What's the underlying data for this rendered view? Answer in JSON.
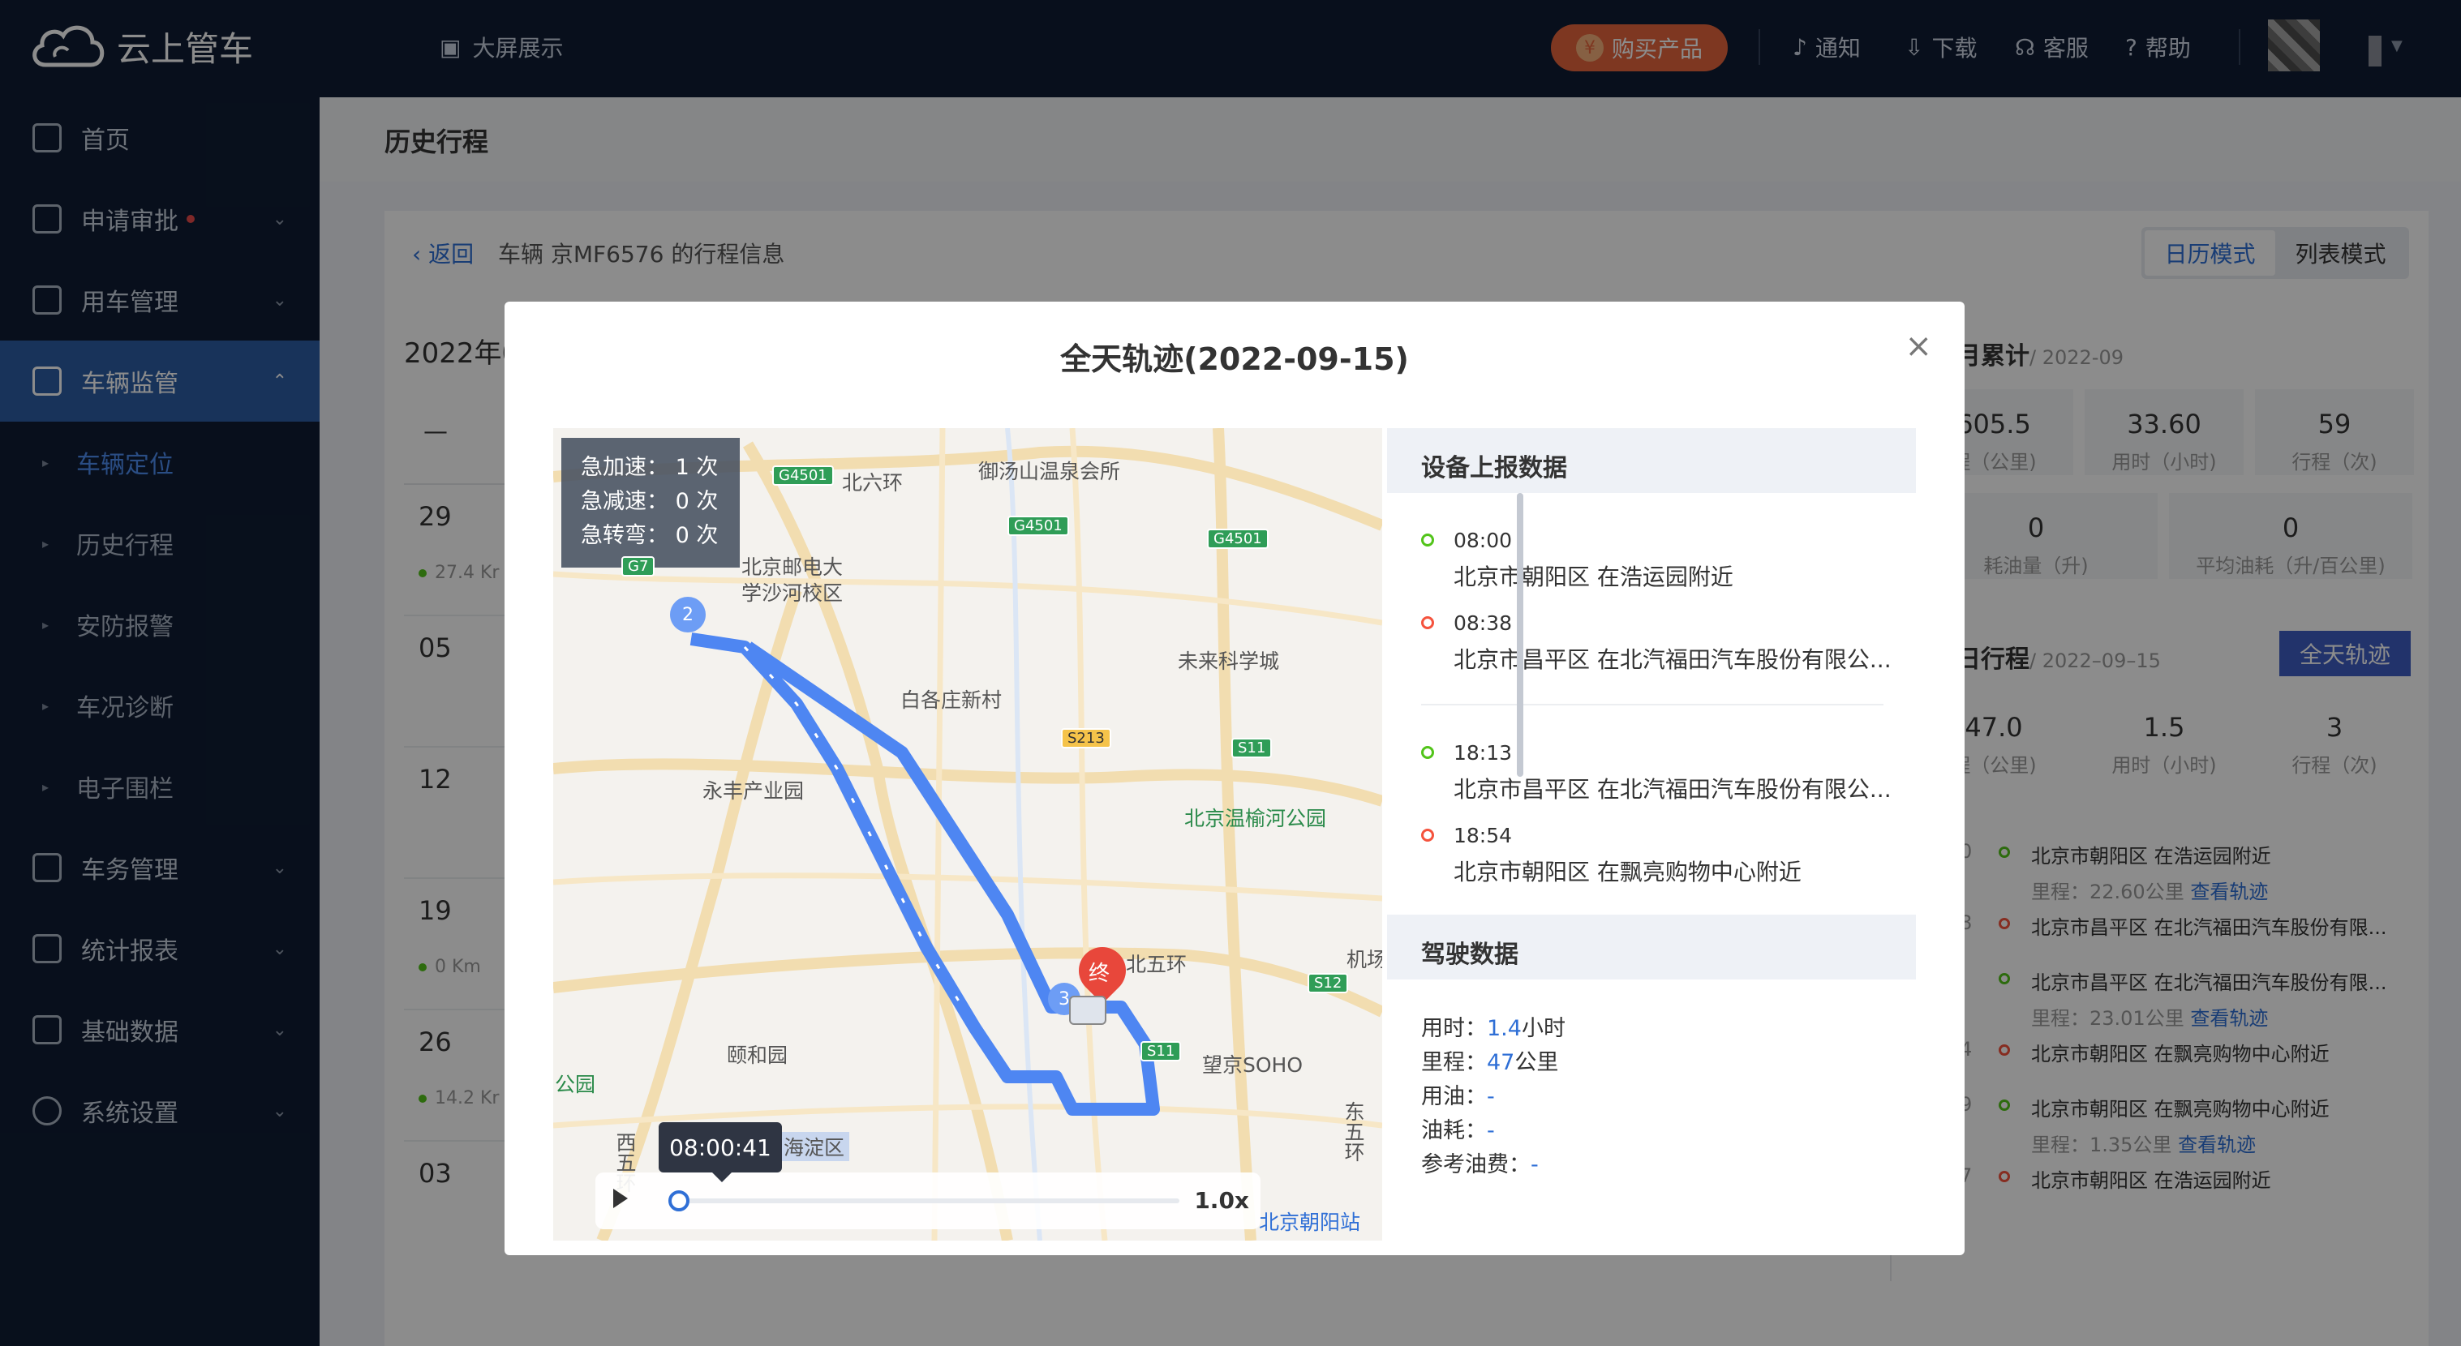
{
  "topbar": {
    "brand": "云上管车",
    "big_screen": "大屏展示",
    "buy": "购买产品",
    "notify": "通知",
    "download": "下载",
    "service": "客服",
    "help": "帮助"
  },
  "sidebar": {
    "items": [
      {
        "label": "首页"
      },
      {
        "label": "申请审批"
      },
      {
        "label": "用车管理"
      },
      {
        "label": "车辆监管"
      },
      {
        "label": "车务管理"
      },
      {
        "label": "统计报表"
      },
      {
        "label": "基础数据"
      },
      {
        "label": "系统设置"
      }
    ],
    "sub_items": [
      {
        "label": "车辆定位"
      },
      {
        "label": "历史行程"
      },
      {
        "label": "安防报警"
      },
      {
        "label": "车况诊断"
      },
      {
        "label": "电子围栏"
      }
    ]
  },
  "page": {
    "title": "历史行程",
    "back": "返回",
    "vehicle_info": "车辆 京MF6576 的行程信息",
    "mode_calendar": "日历模式",
    "mode_list": "列表模式",
    "calendar_title": "2022年0",
    "calendar_dash": "—",
    "weeks": [
      {
        "date": "29",
        "km": "27.4 Kr"
      },
      {
        "date": "05",
        "km": ""
      },
      {
        "date": "12",
        "km": ""
      },
      {
        "date": "19",
        "km": "0 Km"
      },
      {
        "date": "26",
        "km": "14.2 Kr"
      },
      {
        "date": "03",
        "km": ""
      }
    ],
    "month_title": "月累计",
    "month_date": "/ 2022-09",
    "month_stats": [
      {
        "value": "605.5",
        "label": "程（公里)"
      },
      {
        "value": "33.60",
        "label": "用时（小时)"
      },
      {
        "value": "59",
        "label": "行程（次)"
      },
      {
        "value": "0",
        "label": "耗油量（升)"
      },
      {
        "value": "0",
        "label": "平均油耗（升/百公里)"
      }
    ],
    "day_title": "日行程",
    "day_date": "/ 2022–09–15",
    "full_track_button": "全天轨迹",
    "day_stats": [
      {
        "value": "47.0",
        "label": "程（公里)"
      },
      {
        "value": "1.5",
        "label": "用时（小时)"
      },
      {
        "value": "3",
        "label": "行程（次)"
      }
    ],
    "trips": [
      {
        "pre": "0",
        "start": "北京市朝阳区 在浩运园附近",
        "mileage": "里程：22.60公里",
        "link": "查看轨迹",
        "pre2": "8",
        "end": "北京市昌平区 在北汽福田汽车股份有限..."
      },
      {
        "pre": "",
        "start": "北京市昌平区 在北汽福田汽车股份有限...",
        "mileage": "里程：23.01公里",
        "link": "查看轨迹",
        "pre2": "4",
        "end": "北京市朝阳区 在飘亮购物中心附近"
      },
      {
        "pre": "9",
        "start": "北京市朝阳区 在飘亮购物中心附近",
        "mileage": "里程：1.35公里",
        "link": "查看轨迹",
        "pre2": "7",
        "end": "北京市朝阳区 在浩运园附近"
      }
    ]
  },
  "modal": {
    "title": "全天轨迹(2022-09-15)",
    "close": "×",
    "events": [
      {
        "label": "急加速：",
        "value": "1 次"
      },
      {
        "label": "急减速：",
        "value": "0 次"
      },
      {
        "label": "急转弯：",
        "value": "0 次"
      }
    ],
    "map_labels": {
      "l1": "北六环",
      "l2": "御汤山温泉会所",
      "l3": "北京邮电大",
      "l4": "学沙河校区",
      "l5": "未来科学城",
      "l6": "白各庄新村",
      "l7": "永丰产业园",
      "l8": "北京温榆河公园",
      "l9": "北五环",
      "l10": "颐和园",
      "l11": "望京SOHO",
      "l12": "海淀区",
      "l13": "公园",
      "l14": "北京朝阳站",
      "l15": "东五环",
      "l16": "西五环",
      "l17": "机场",
      "end_marker": "终",
      "waypoint2": "2",
      "waypoint3": "3"
    },
    "road_badges": [
      "G4501",
      "G4501",
      "G4501",
      "G7",
      "S213",
      "S11",
      "S12",
      "S11"
    ],
    "player": {
      "time": "08:00:41",
      "speed": "1.0x"
    },
    "device_header": "设备上报数据",
    "device_points": [
      {
        "time": "08:00",
        "addr": "北京市朝阳区 在浩运园附近",
        "color": "#52c41a"
      },
      {
        "time": "08:38",
        "addr": "北京市昌平区 在北汽福田汽车股份有限公...",
        "color": "#f5533d"
      },
      {
        "time": "18:13",
        "addr": "北京市昌平区 在北汽福田汽车股份有限公...",
        "color": "#52c41a"
      },
      {
        "time": "18:54",
        "addr": "北京市朝阳区 在飘亮购物中心附近",
        "color": "#f5533d"
      }
    ],
    "drive_header": "驾驶数据",
    "drive": [
      {
        "label": "用时：",
        "value": "1.4",
        "unit": "小时"
      },
      {
        "label": "里程：",
        "value": "47",
        "unit": "公里"
      },
      {
        "label": "用油：",
        "value": "-",
        "unit": ""
      },
      {
        "label": "油耗：",
        "value": "-",
        "unit": ""
      },
      {
        "label": "参考油费：",
        "value": "-",
        "unit": ""
      }
    ]
  }
}
